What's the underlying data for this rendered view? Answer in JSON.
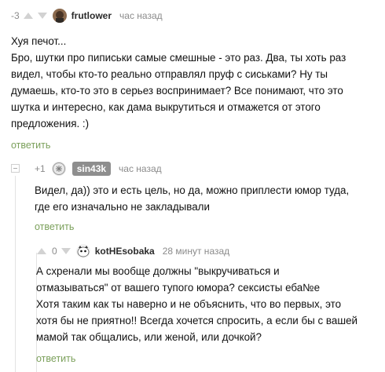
{
  "comments": [
    {
      "rating": "-3",
      "author": "frutlower",
      "time": "час назад",
      "lines": [
        "Хуя печот...",
        "Бро, шутки про пиписьки самые смешные - это раз. Два, ты хоть раз",
        "видел, чтобы кто-то реально отправлял пруф с сиськами? Ну ты",
        "думаешь, кто-то это в серьез воспринимает? Все понимают, что это",
        "шутка и интересно, как дама выкрутиться и отмажется от этого",
        "предложения. :)"
      ],
      "reply_label": "ответить"
    },
    {
      "rating": "+1",
      "author": "sin43k",
      "time": "час назад",
      "lines": [
        "Видел, да)) это и есть цель, но да, можно приплести юмор туда,",
        "где его изначально не закладывали"
      ],
      "reply_label": "ответить"
    },
    {
      "rating": "0",
      "author": "kotHEsobaka",
      "time": "28 минут назад",
      "lines": [
        "А схренали мы вообще должны \"выкручиваться и",
        "отмазываться\" от вашего тупого юмора? сексисты еба№е",
        "Хотя таким как ты наверно и не объяснить, что во первых, это",
        "хотя бы не приятно!! Всегда хочется спросить, а если бы с вашей",
        "мамой так общались, или женой, или дочкой?"
      ],
      "reply_label": "ответить"
    }
  ],
  "colors": {
    "accent": "#7ba05b",
    "muted": "#8b8b8b",
    "badge": "#8e8e8e"
  }
}
